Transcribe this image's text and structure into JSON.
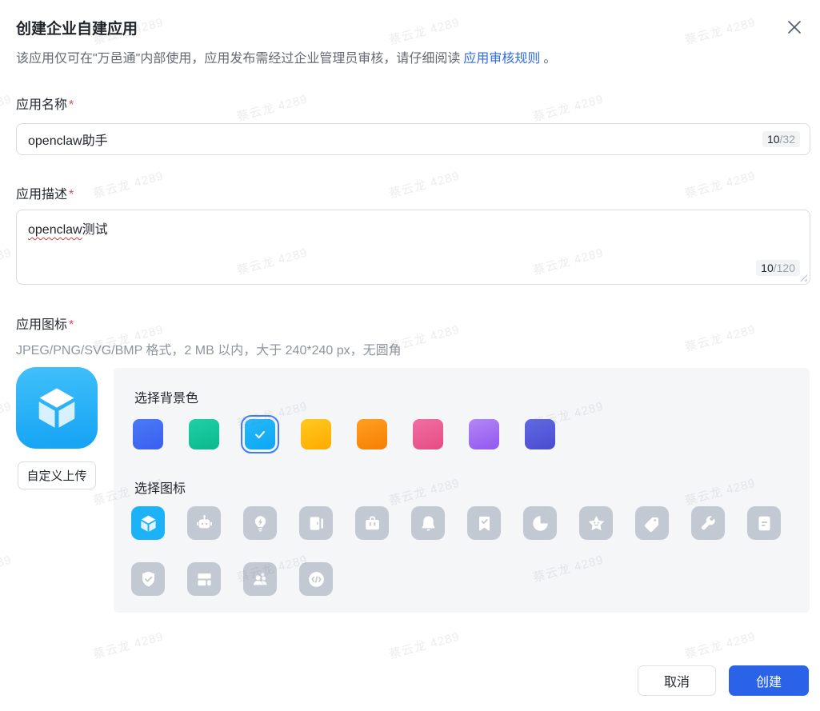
{
  "dialog": {
    "title": "创建企业自建应用",
    "subtitle_prefix": "该应用仅可在\"万邑通\"内部使用，应用发布需经过企业管理员审核，请仔细阅读",
    "subtitle_link": "应用审核规则",
    "subtitle_suffix": "。"
  },
  "watermark": {
    "text": "蔡云龙 4289"
  },
  "fields": {
    "name": {
      "label": "应用名称",
      "required_mark": "*",
      "value": "openclaw助手",
      "counter_current": "10",
      "counter_max": "/32"
    },
    "description": {
      "label": "应用描述",
      "required_mark": "*",
      "value_highlight": "openclaw",
      "value_rest": "测试",
      "counter_current": "10",
      "counter_max": "/120"
    },
    "icon": {
      "label": "应用图标",
      "required_mark": "*",
      "hint": "JPEG/PNG/SVG/BMP 格式，2 MB 以内，大于 240*240 px，无圆角",
      "upload_button": "自定义上传"
    }
  },
  "background_section": {
    "title": "选择背景色",
    "colors": [
      {
        "name": "blue",
        "from": "#4a7bf5",
        "to": "#3a5ef0",
        "selected": false
      },
      {
        "name": "green",
        "from": "#1ed0a8",
        "to": "#0cb88d",
        "selected": false
      },
      {
        "name": "sky",
        "from": "#27b8f9",
        "to": "#0ca7f3",
        "selected": true
      },
      {
        "name": "yellow",
        "from": "#ffc91f",
        "to": "#ffaa00",
        "selected": false
      },
      {
        "name": "orange",
        "from": "#ff9f1f",
        "to": "#f77f06",
        "selected": false
      },
      {
        "name": "pink",
        "from": "#f06fa4",
        "to": "#e64c82",
        "selected": false
      },
      {
        "name": "purple",
        "from": "#b287f7",
        "to": "#9357ee",
        "selected": false
      },
      {
        "name": "indigo",
        "from": "#5f6ae4",
        "to": "#4b4bd0",
        "selected": false
      }
    ]
  },
  "icon_section": {
    "title": "选择图标",
    "icons": [
      {
        "name": "cube",
        "selected": true
      },
      {
        "name": "robot",
        "selected": false
      },
      {
        "name": "bulb",
        "selected": false
      },
      {
        "name": "door",
        "selected": false
      },
      {
        "name": "briefcase",
        "selected": false
      },
      {
        "name": "bell",
        "selected": false
      },
      {
        "name": "bookmark-check",
        "selected": false
      },
      {
        "name": "pie-chart",
        "selected": false
      },
      {
        "name": "star",
        "selected": false
      },
      {
        "name": "tag",
        "selected": false
      },
      {
        "name": "wrench",
        "selected": false
      },
      {
        "name": "document",
        "selected": false
      },
      {
        "name": "shield-check",
        "selected": false
      },
      {
        "name": "layout",
        "selected": false
      },
      {
        "name": "users",
        "selected": false
      },
      {
        "name": "code",
        "selected": false
      }
    ]
  },
  "footer": {
    "cancel": "取消",
    "confirm": "创建"
  },
  "colors": {
    "accent": "#2a63e8",
    "link": "#2f6be6",
    "selected_tile": "#1db2f8",
    "tile_gray": "#c3c9d2",
    "panel_bg": "#f5f6f8"
  }
}
